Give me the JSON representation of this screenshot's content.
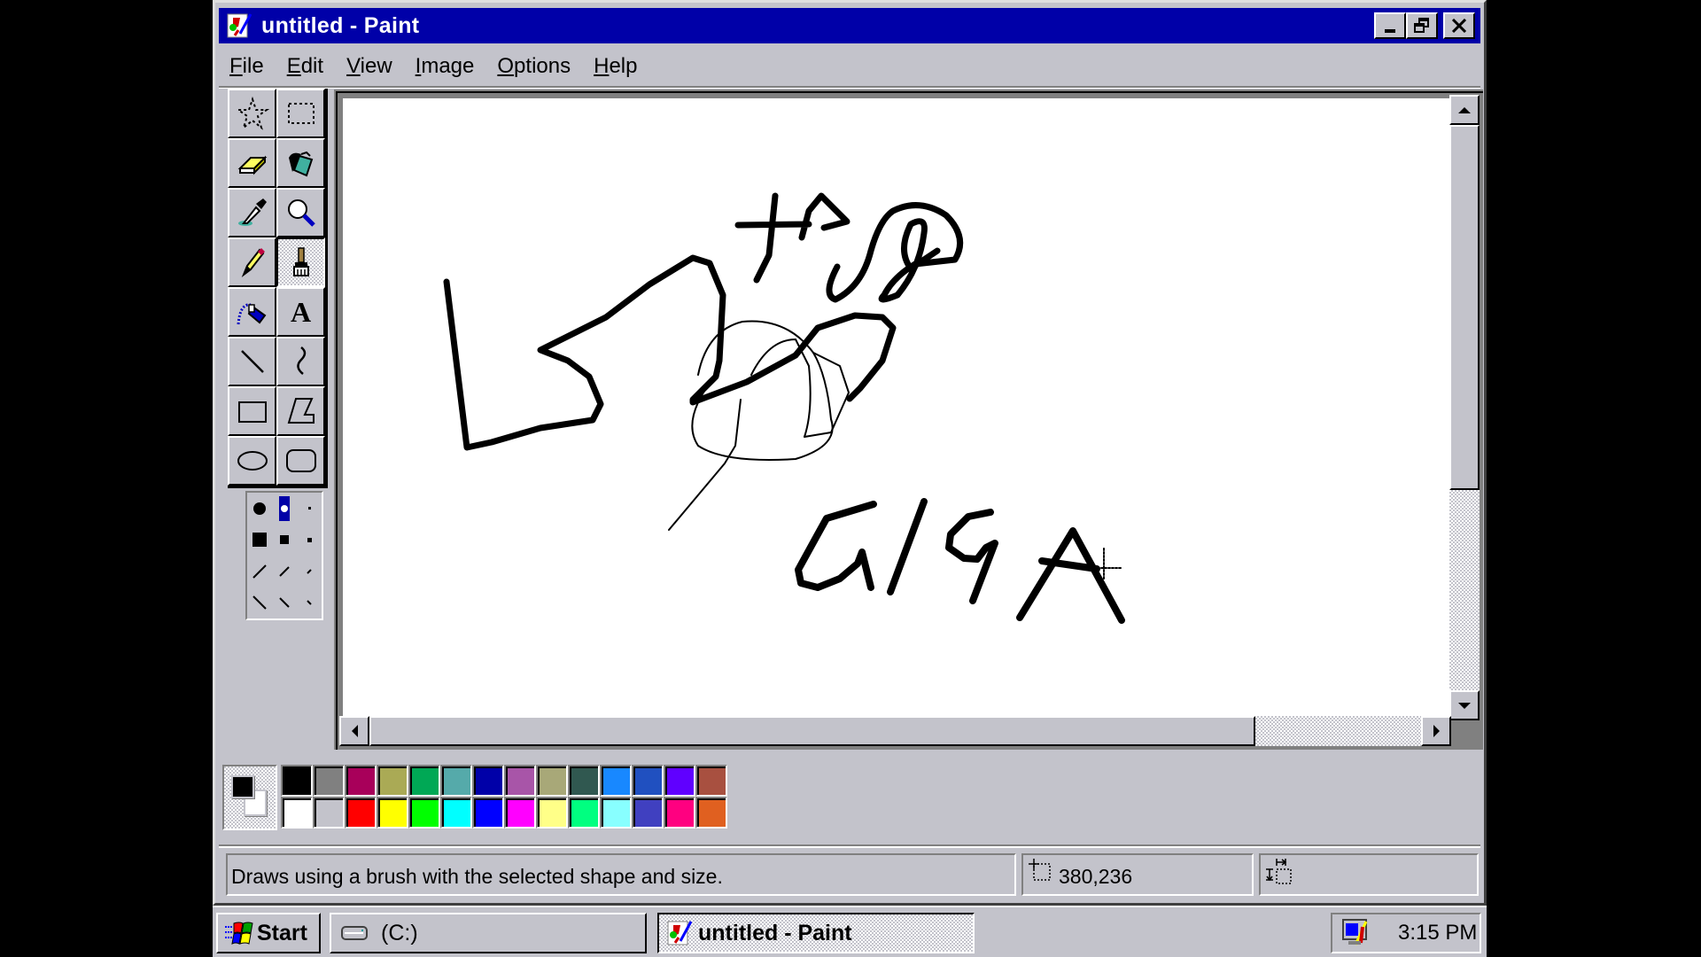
{
  "window": {
    "title": "untitled - Paint",
    "controls": {
      "minimize": "minimize",
      "restore": "restore",
      "close": "close"
    }
  },
  "menu": [
    {
      "label": "File",
      "accel": "F"
    },
    {
      "label": "Edit",
      "accel": "E"
    },
    {
      "label": "View",
      "accel": "V"
    },
    {
      "label": "Image",
      "accel": "I"
    },
    {
      "label": "Options",
      "accel": "O"
    },
    {
      "label": "Help",
      "accel": "H"
    }
  ],
  "menu_labels": {
    "file_rest": "ile",
    "edit_rest": "dit",
    "view_rest": "iew",
    "image_rest": "mage",
    "options_rest": "ptions",
    "help_rest": "elp",
    "file_acc": "F",
    "edit_acc": "E",
    "view_acc": "V",
    "image_acc": "I",
    "options_acc": "O",
    "help_acc": "H"
  },
  "tools": [
    {
      "name": "free-form-select",
      "icon": "star-select-icon"
    },
    {
      "name": "select",
      "icon": "rect-select-icon"
    },
    {
      "name": "eraser",
      "icon": "eraser-icon"
    },
    {
      "name": "fill-with-color",
      "icon": "paint-bucket-icon"
    },
    {
      "name": "pick-color",
      "icon": "eyedropper-icon"
    },
    {
      "name": "magnifier",
      "icon": "magnifier-icon"
    },
    {
      "name": "pencil",
      "icon": "pencil-icon"
    },
    {
      "name": "brush",
      "icon": "brush-icon",
      "active": true
    },
    {
      "name": "airbrush",
      "icon": "airbrush-icon"
    },
    {
      "name": "text",
      "icon": "text-icon",
      "glyph": "A"
    },
    {
      "name": "line",
      "icon": "line-icon"
    },
    {
      "name": "curve",
      "icon": "curve-icon"
    },
    {
      "name": "rectangle",
      "icon": "rectangle-icon"
    },
    {
      "name": "polygon",
      "icon": "polygon-icon"
    },
    {
      "name": "ellipse",
      "icon": "ellipse-icon"
    },
    {
      "name": "rounded-rectangle",
      "icon": "rounded-rectangle-icon"
    }
  ],
  "brush_options": {
    "selected": "round-medium",
    "options": [
      "round-large",
      "round-medium",
      "round-small",
      "square-large",
      "square-medium",
      "square-small",
      "slash-large",
      "slash-medium",
      "slash-small",
      "backslash-large",
      "backslash-medium",
      "backslash-small"
    ]
  },
  "colors": {
    "foreground": "#000000",
    "background": "#ffffff",
    "title_bar": "#0000a8",
    "face": "#c3c3cb",
    "palette_row1": [
      "#000000",
      "#808080",
      "#a8005a",
      "#aaaa55",
      "#00a855",
      "#55aaaa",
      "#0000a8",
      "#a855a8",
      "#a8a878",
      "#305850",
      "#1888ff",
      "#2050c0",
      "#6000ff",
      "#a85040"
    ],
    "palette_row2": [
      "#ffffff",
      "#c3c3cb",
      "#ff0000",
      "#ffff00",
      "#00ff00",
      "#00ffff",
      "#0000ff",
      "#ff00ff",
      "#ffff88",
      "#00ff80",
      "#88ffff",
      "#4040c0",
      "#ff0080",
      "#e06020"
    ]
  },
  "status": {
    "message": "Draws using a brush with the selected shape and size.",
    "position": "380,236",
    "size": ""
  },
  "taskbar": {
    "start": "Start",
    "drive": "(C:)",
    "active_app": "untitled - Paint",
    "clock": "3:15 PM"
  },
  "canvas": {
    "drawn_text": "Ha GIGA"
  }
}
